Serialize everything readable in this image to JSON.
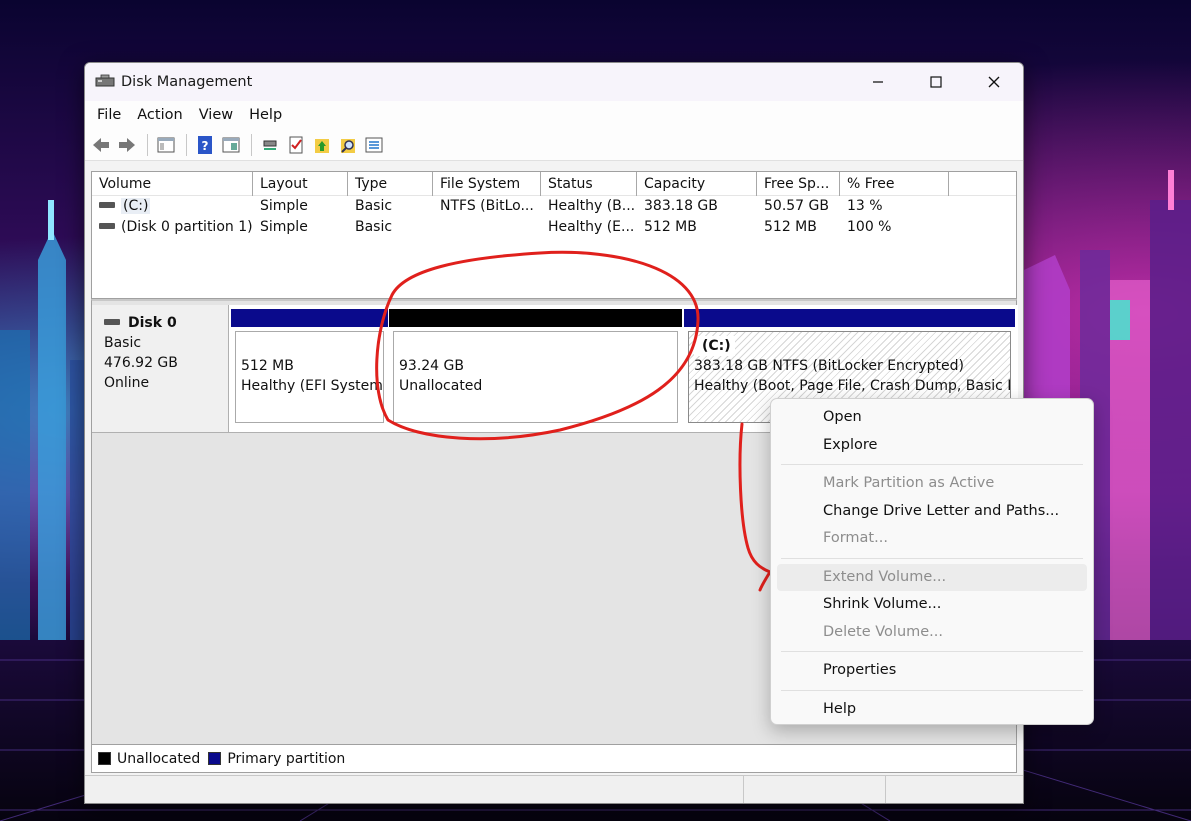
{
  "window": {
    "title": "Disk Management",
    "controls": [
      "minimize",
      "maximize",
      "close"
    ]
  },
  "menubar": [
    "File",
    "Action",
    "View",
    "Help"
  ],
  "toolbar_icons": [
    "back-arrow-icon",
    "forward-arrow-icon",
    "console-tree-icon",
    "help-icon",
    "properties-pane-icon",
    "connect-icon",
    "checklist-icon",
    "folder-up-icon",
    "folder-search-icon",
    "list-view-icon"
  ],
  "volume_list": {
    "columns": [
      "Volume",
      "Layout",
      "Type",
      "File System",
      "Status",
      "Capacity",
      "Free Sp...",
      "% Free"
    ],
    "rows": [
      [
        "(C:)",
        "Simple",
        "Basic",
        "NTFS (BitLo...",
        "Healthy (B...",
        "383.18 GB",
        "50.57 GB",
        "13 %"
      ],
      [
        "(Disk 0 partition 1)",
        "Simple",
        "Basic",
        "",
        "Healthy (E...",
        "512 MB",
        "512 MB",
        "100 %"
      ]
    ]
  },
  "disk": {
    "name": "Disk 0",
    "type": "Basic",
    "size": "476.92 GB",
    "state": "Online"
  },
  "partitions": [
    {
      "size": "512 MB",
      "status": "Healthy (EFI System",
      "bar_color": "#0a0a8c"
    },
    {
      "size": "93.24 GB",
      "status": "Unallocated",
      "bar_color": "#000000"
    },
    {
      "label": "(C:)",
      "size": "383.18 GB NTFS (BitLocker Encrypted)",
      "status": "Healthy (Boot, Page File, Crash Dump, Basic Da",
      "bar_color": "#0a0a8c"
    }
  ],
  "legend": [
    {
      "label": "Unallocated",
      "color": "#000000"
    },
    {
      "label": "Primary partition",
      "color": "#0a0a8c"
    }
  ],
  "context_menu": [
    {
      "label": "Open",
      "disabled": false
    },
    {
      "label": "Explore",
      "disabled": false
    },
    {
      "separator": true
    },
    {
      "label": "Mark Partition as Active",
      "disabled": true
    },
    {
      "label": "Change Drive Letter and Paths...",
      "disabled": false
    },
    {
      "label": "Format...",
      "disabled": true
    },
    {
      "separator": true
    },
    {
      "label": "Extend Volume...",
      "disabled": true,
      "hover": true
    },
    {
      "label": "Shrink Volume...",
      "disabled": false
    },
    {
      "label": "Delete Volume...",
      "disabled": true
    },
    {
      "separator": true
    },
    {
      "label": "Properties",
      "disabled": false
    },
    {
      "separator": true
    },
    {
      "label": "Help",
      "disabled": false
    }
  ],
  "colors": {
    "primary_partition": "#0a0a8c",
    "unallocated": "#000000",
    "annotation": "#e0201c"
  }
}
